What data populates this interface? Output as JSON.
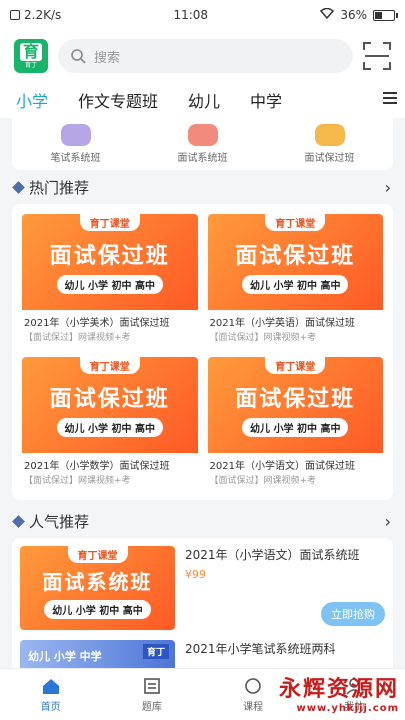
{
  "status": {
    "net": "2.2K/s",
    "time": "11:08",
    "battery": "36%",
    "battery_level": 0.36
  },
  "header": {
    "logo_big": "育",
    "logo_small": "育丁",
    "search_placeholder": "搜索"
  },
  "tabs": [
    {
      "label": "小学"
    },
    {
      "label": "作文专题班"
    },
    {
      "label": "幼儿"
    },
    {
      "label": "中学"
    }
  ],
  "categories": [
    {
      "label": "笔试系统班",
      "color": "#b6a6e6"
    },
    {
      "label": "面试系统班",
      "color": "#f28b7e"
    },
    {
      "label": "面试保过班",
      "color": "#f5b84a"
    }
  ],
  "hot": {
    "title": "热门推荐",
    "cards": [
      {
        "brand": "育丁课堂",
        "banner": "面试保过班",
        "sub": "幼儿 小学 初中 高中",
        "t1": "2021年（小学美术）面试保过班",
        "t2": "【面试保过】网课视频+考"
      },
      {
        "brand": "育丁课堂",
        "banner": "面试保过班",
        "sub": "幼儿 小学 初中 高中",
        "t1": "2021年（小学英语）面试保过班",
        "t2": "【面试保过】网课视频+考"
      },
      {
        "brand": "育丁课堂",
        "banner": "面试保过班",
        "sub": "幼儿 小学 初中 高中",
        "t1": "2021年（小学数学）面试保过班",
        "t2": "【面试保过】网课视频+考"
      },
      {
        "brand": "育丁课堂",
        "banner": "面试保过班",
        "sub": "幼儿 小学 初中 高中",
        "t1": "2021年（小学语文）面试保过班",
        "t2": "【面试保过】网课视频+考"
      }
    ]
  },
  "popular": {
    "title": "人气推荐",
    "item": {
      "brand": "育丁课堂",
      "banner": "面试系统班",
      "sub": "幼儿 小学 初中 高中",
      "title": "2021年（小学语文）面试系统班",
      "price": "¥99",
      "btn": "立即抢购"
    },
    "item2": {
      "mini": "幼儿 小学 中学",
      "tag": "育丁",
      "title": "2021年小学笔试系统班两科"
    }
  },
  "nav": [
    {
      "label": "首页"
    },
    {
      "label": "题库"
    },
    {
      "label": "课程"
    },
    {
      "label": "我的"
    }
  ],
  "watermark": {
    "main": "永辉资源网",
    "url": "www.yhkjjj.com"
  }
}
